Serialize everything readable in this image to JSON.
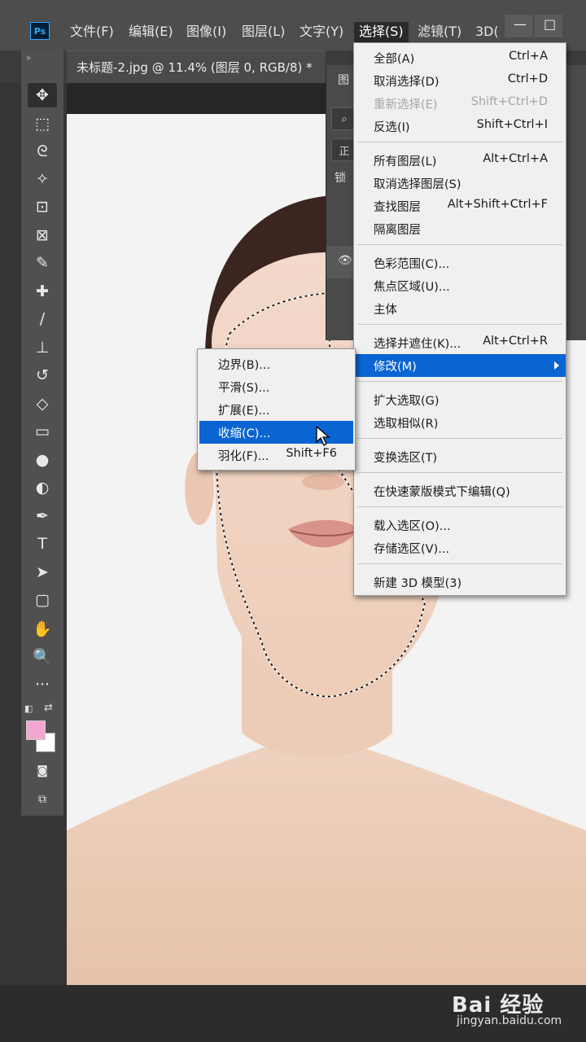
{
  "app": {
    "logo": "Ps"
  },
  "menubar": {
    "items": [
      {
        "label": "文件(F)"
      },
      {
        "label": "编辑(E)"
      },
      {
        "label": "图像(I)"
      },
      {
        "label": "图层(L)"
      },
      {
        "label": "文字(Y)"
      },
      {
        "label": "选择(S)"
      },
      {
        "label": "滤镜(T)"
      },
      {
        "label": "3D("
      }
    ],
    "minimize": "—",
    "restore": "□"
  },
  "document": {
    "tab_title": "未标题-2.jpg @ 11.4% (图层 0, RGB/8) *"
  },
  "layers_panel": {
    "title": "图",
    "mode": "正",
    "lock": "锁"
  },
  "toolbar": {
    "collapse": "»",
    "tools": [
      {
        "name": "move-tool",
        "glyph": "✥"
      },
      {
        "name": "marquee-tool",
        "glyph": "⬚"
      },
      {
        "name": "lasso-tool",
        "glyph": "ᘓ"
      },
      {
        "name": "magic-wand-tool",
        "glyph": "✧"
      },
      {
        "name": "crop-tool",
        "glyph": "⊡"
      },
      {
        "name": "frame-tool",
        "glyph": "⊠"
      },
      {
        "name": "eyedropper-tool",
        "glyph": "✎"
      },
      {
        "name": "healing-brush-tool",
        "glyph": "✚"
      },
      {
        "name": "brush-tool",
        "glyph": "∕"
      },
      {
        "name": "clone-stamp-tool",
        "glyph": "⊥"
      },
      {
        "name": "history-brush-tool",
        "glyph": "↺"
      },
      {
        "name": "eraser-tool",
        "glyph": "◇"
      },
      {
        "name": "gradient-tool",
        "glyph": "▭"
      },
      {
        "name": "blur-tool",
        "glyph": "●"
      },
      {
        "name": "dodge-tool",
        "glyph": "◐"
      },
      {
        "name": "pen-tool",
        "glyph": "✒"
      },
      {
        "name": "type-tool",
        "glyph": "T"
      },
      {
        "name": "path-selection-tool",
        "glyph": "➤"
      },
      {
        "name": "rectangle-tool",
        "glyph": "▢"
      },
      {
        "name": "hand-tool",
        "glyph": "✋"
      },
      {
        "name": "zoom-tool",
        "glyph": "🔍"
      },
      {
        "name": "more-tools",
        "glyph": "···"
      }
    ],
    "foreground_color": "#f4a6d2",
    "background_color": "#ffffff"
  },
  "select_menu": {
    "items": [
      {
        "label": "全部(A)",
        "shortcut": "Ctrl+A",
        "disabled": false
      },
      {
        "label": "取消选择(D)",
        "shortcut": "Ctrl+D",
        "disabled": false
      },
      {
        "label": "重新选择(E)",
        "shortcut": "Shift+Ctrl+D",
        "disabled": true
      },
      {
        "label": "反选(I)",
        "shortcut": "Shift+Ctrl+I",
        "disabled": false
      },
      {
        "label": "所有图层(L)",
        "shortcut": "Alt+Ctrl+A",
        "disabled": false
      },
      {
        "label": "取消选择图层(S)",
        "shortcut": "",
        "disabled": false
      },
      {
        "label": "查找图层",
        "shortcut": "Alt+Shift+Ctrl+F",
        "disabled": false
      },
      {
        "label": "隔离图层",
        "shortcut": "",
        "disabled": false
      },
      {
        "label": "色彩范围(C)...",
        "shortcut": "",
        "disabled": false
      },
      {
        "label": "焦点区域(U)...",
        "shortcut": "",
        "disabled": false
      },
      {
        "label": "主体",
        "shortcut": "",
        "disabled": false
      },
      {
        "label": "选择并遮住(K)...",
        "shortcut": "Alt+Ctrl+R",
        "disabled": false
      },
      {
        "label": "修改(M)",
        "shortcut": "",
        "disabled": false,
        "highlighted": true
      },
      {
        "label": "扩大选取(G)",
        "shortcut": "",
        "disabled": false
      },
      {
        "label": "选取相似(R)",
        "shortcut": "",
        "disabled": false
      },
      {
        "label": "变换选区(T)",
        "shortcut": "",
        "disabled": false
      },
      {
        "label": "在快速蒙版模式下编辑(Q)",
        "shortcut": "",
        "disabled": false
      },
      {
        "label": "载入选区(O)...",
        "shortcut": "",
        "disabled": false
      },
      {
        "label": "存储选区(V)...",
        "shortcut": "",
        "disabled": false
      },
      {
        "label": "新建 3D 模型(3)",
        "shortcut": "",
        "disabled": false
      }
    ]
  },
  "modify_submenu": {
    "items": [
      {
        "label": "边界(B)...",
        "shortcut": ""
      },
      {
        "label": "平滑(S)...",
        "shortcut": ""
      },
      {
        "label": "扩展(E)...",
        "shortcut": ""
      },
      {
        "label": "收缩(C)...",
        "shortcut": "",
        "highlighted": true
      },
      {
        "label": "羽化(F)...",
        "shortcut": "Shift+F6"
      }
    ]
  },
  "watermark": {
    "brand": "Bai 经验",
    "url": "jingyan.baidu.com"
  },
  "colors": {
    "highlight": "#0a64d2",
    "menu_bg": "#f0f0f0"
  }
}
